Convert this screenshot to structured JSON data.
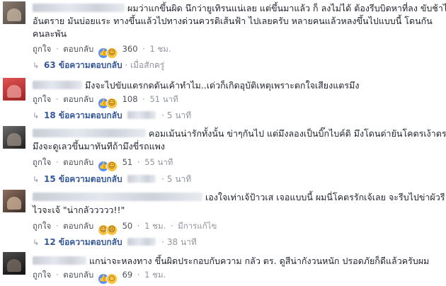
{
  "ui": {
    "like_label": "ถูกใจ",
    "reply_label": "ตอบกลับ",
    "separator": "·"
  },
  "comments": [
    {
      "text_lines": [
        "ผมว่าแกขึ้นผิด นึกว่ายูเทิรนแน่เลย แต่ขึ้นมาแล้ว ก็ ลงไม่ได้ ต้องรีบบิดหาที่ลง ขับช้าไม่ได้อีก",
        "อันตราย มันบ่อยแระ ทางขึ้นแล้วไปทางด่วนควรติเส้นฟ้า ไปเลยครับ หลายคนแล้วหลงขึ้นไปแบบนี้ โดนกัน",
        "คนละพัน"
      ],
      "reaction_count": "360",
      "time": "1 ชม.",
      "edited": "",
      "replies": {
        "count_label": "63 ข้อความตอบกลับ",
        "meta": "เมื่อสักครู่"
      }
    },
    {
      "text_lines": [
        "มึงจะไปขับแตรกดดันเค้าทำไม..เด่วก็เกิดอุบัติเหตุเพราะตกใจเสียงแตรมึง"
      ],
      "reaction_count": "108",
      "time": "51 นาที",
      "edited": "",
      "replies": {
        "count_label": "18 ข้อความตอบกลับ",
        "meta": "5 นาที"
      }
    },
    {
      "text_lines": [
        "คอมเม้นน่ารักทั้งนั้น ข่าๆกันไป แต่มึงลองเป็นบิ๊กไบค์ดิ มึงโดนด่ายันโคตรเง้าตระกูล",
        "มึงจะดูเลวขึ้นมาทันทีถ้ามึงขี่รถแพง"
      ],
      "reaction_count": "51",
      "time": "55 นาที",
      "edited": "",
      "replies": {
        "count_label": "15 ข้อความตอบกลับ",
        "meta": "5 นาที"
      }
    },
    {
      "text_lines": [
        "เองใจเท่าเจ้ป้าวเส เจอแบบนี้ ผมนี่โคตรรักเจ้เลย จะรีบไปข่าผัวรี",
        "ไวจะเจ้ \"น่ากลัววววว!!\""
      ],
      "reaction_count": "50",
      "time": "1 ชม.",
      "edited": "มีการแก้ไข",
      "replies": {
        "count_label": "12 ข้อความตอบกลับ",
        "meta": "38 นาที"
      }
    },
    {
      "text_lines": [
        "แกน่าจะหลงทาง ขึ้นผิดประกอบกับความ กลัว ตร. ดูสีน่ากังวนหนัก ปรอดภัยก็ดีแล้วครับผม"
      ],
      "reaction_count": "69",
      "time": "1 ชม.",
      "edited": "",
      "replies": null
    }
  ],
  "colors": {
    "link": "#365899",
    "meta": "#90949c",
    "like_blue": "#5890ff",
    "emoji_yellow": "#f7c242"
  }
}
